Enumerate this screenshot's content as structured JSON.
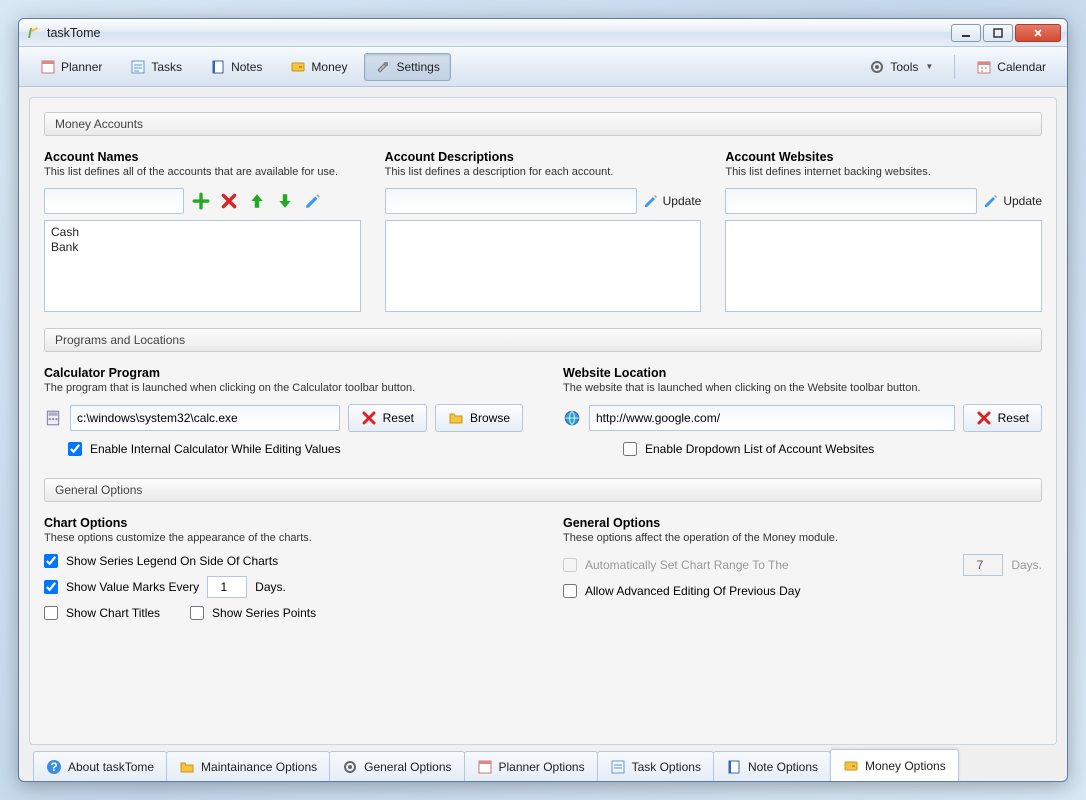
{
  "window": {
    "title": "taskTome"
  },
  "toolbar": {
    "planner": "Planner",
    "tasks": "Tasks",
    "notes": "Notes",
    "money": "Money",
    "settings": "Settings",
    "tools": "Tools",
    "calendar": "Calendar"
  },
  "moneyAccounts": {
    "header": "Money Accounts",
    "names": {
      "title": "Account Names",
      "desc": "This list defines all of the accounts that are available for use.",
      "items": [
        "Cash",
        "Bank"
      ],
      "input": ""
    },
    "descriptions": {
      "title": "Account Descriptions",
      "desc": "This list defines a description for each account.",
      "update": "Update"
    },
    "websites": {
      "title": "Account Websites",
      "desc": "This list defines internet backing websites.",
      "update": "Update"
    }
  },
  "programs": {
    "header": "Programs and Locations",
    "calc": {
      "title": "Calculator Program",
      "desc": "The program that is launched when clicking on the Calculator toolbar button.",
      "path": "c:\\windows\\system32\\calc.exe",
      "reset": "Reset",
      "browse": "Browse",
      "enableInternal": "Enable Internal Calculator While Editing Values",
      "enableInternalChecked": true
    },
    "web": {
      "title": "Website Location",
      "desc": "The website that is launched when clicking on the Website toolbar button.",
      "url": "http://www.google.com/",
      "reset": "Reset",
      "enableDropdown": "Enable Dropdown List of Account Websites",
      "enableDropdownChecked": false
    }
  },
  "general": {
    "header": "General Options",
    "chart": {
      "title": "Chart Options",
      "desc": "These options customize the appearance of the charts.",
      "showLegend": "Show Series Legend On Side Of Charts",
      "showLegendChecked": true,
      "showValueMarks": "Show Value Marks Every",
      "showValueMarksChecked": true,
      "valueMarksDays": "1",
      "daysLabel": "Days.",
      "showTitles": "Show Chart Titles",
      "showTitlesChecked": false,
      "showPoints": "Show Series Points",
      "showPointsChecked": false
    },
    "genOpts": {
      "title": "General Options",
      "desc": "These options affect the operation of the Money module.",
      "autoRange": "Automatically Set Chart Range To The",
      "autoRangeChecked": false,
      "autoRangeDays": "7",
      "daysLabel": "Days.",
      "allowAdvanced": "Allow Advanced Editing Of Previous Day",
      "allowAdvancedChecked": false
    }
  },
  "bottomTabs": {
    "about": "About taskTome",
    "maint": "Maintainance Options",
    "general": "General Options",
    "planner": "Planner Options",
    "task": "Task Options",
    "note": "Note Options",
    "money": "Money Options"
  }
}
